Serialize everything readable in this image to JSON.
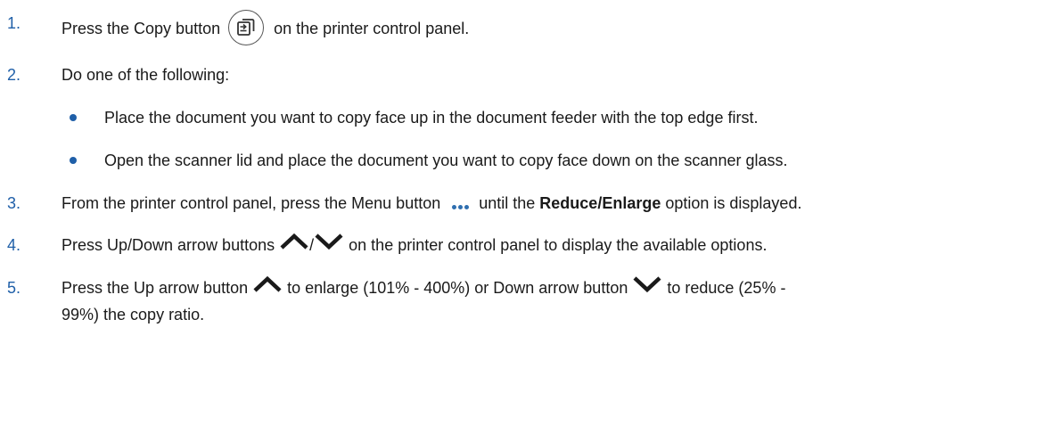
{
  "steps": [
    {
      "num": "1.",
      "before": "Press the Copy button",
      "after": "on the printer control panel."
    },
    {
      "num": "2.",
      "text": "Do one of the following:"
    },
    {
      "num": "3.",
      "before": "From the printer control panel, press the Menu button",
      "middle": "until the",
      "bold": "Reduce/Enlarge",
      "after": "option is displayed."
    },
    {
      "num": "4.",
      "before": "Press Up/Down arrow buttons",
      "slash": "/",
      "after": "on the printer control panel to display the available options."
    },
    {
      "num": "5.",
      "before": "Press the Up arrow button",
      "middle": "to enlarge (101% - 400%) or Down arrow button",
      "after": "to reduce (25% -",
      "line2": "99%) the copy ratio."
    }
  ],
  "bullets": [
    "Place the document you want to copy face up in the document feeder with the top edge first.",
    "Open the scanner lid and place the document you want to copy face down on the scanner glass."
  ],
  "icons": {
    "copy": "copy-icon",
    "menu": "menu-dots-icon",
    "up": "up-arrow-icon",
    "down": "down-arrow-icon"
  },
  "colors": {
    "number": "#1f5fa8",
    "text": "#1a1a1a"
  }
}
